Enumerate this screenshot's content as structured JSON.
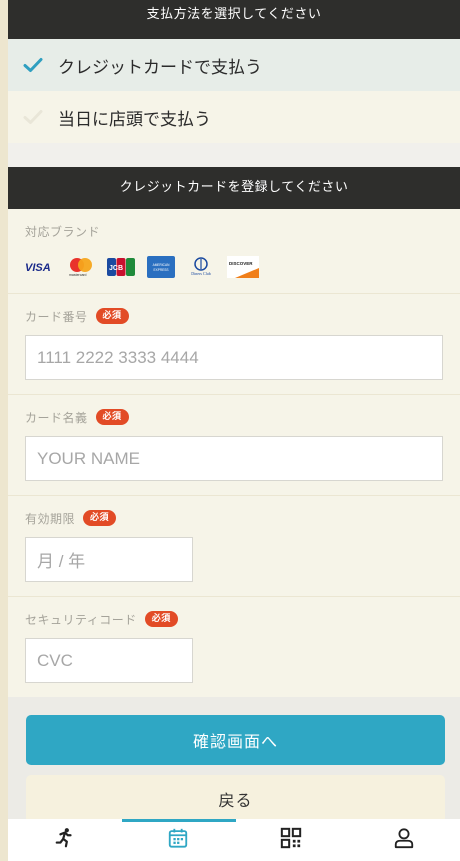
{
  "payment_method": {
    "title": "支払方法を選択してください",
    "options": [
      {
        "label": "クレジットカードで支払う",
        "selected": true
      },
      {
        "label": "当日に店頭で支払う",
        "selected": false
      }
    ]
  },
  "card_form": {
    "title": "クレジットカードを登録してください",
    "brands_label": "対応ブランド",
    "brands": [
      "VISA",
      "mastercard",
      "JCB",
      "AMERICAN EXPRESS",
      "Diners Club",
      "DISCOVER"
    ],
    "required_badge": "必須",
    "card_number": {
      "label": "カード番号",
      "placeholder": "1111 2222 3333 4444"
    },
    "card_name": {
      "label": "カード名義",
      "placeholder": "YOUR NAME"
    },
    "expiry": {
      "label": "有効期限",
      "placeholder": "月 / 年"
    },
    "security_code": {
      "label": "セキュリティコード",
      "placeholder": "CVC"
    }
  },
  "actions": {
    "confirm_label": "確認画面へ",
    "back_label": "戻る"
  },
  "tabbar": {
    "tabs": [
      "running-icon",
      "calendar-icon",
      "qr-code-icon",
      "user-icon"
    ],
    "active_index": 1
  },
  "colors": {
    "accent": "#2fa7c4",
    "required": "#e24b26",
    "check": "#2f9fc0"
  }
}
